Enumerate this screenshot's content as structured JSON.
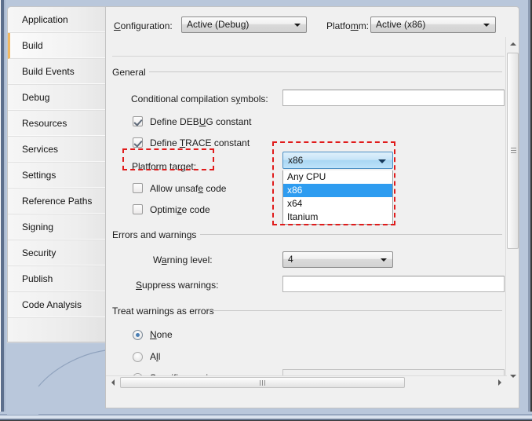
{
  "sidebar": {
    "items": [
      {
        "label": "Application",
        "selected": false
      },
      {
        "label": "Build",
        "selected": true
      },
      {
        "label": "Build Events",
        "selected": false
      },
      {
        "label": "Debug",
        "selected": false
      },
      {
        "label": "Resources",
        "selected": false
      },
      {
        "label": "Services",
        "selected": false
      },
      {
        "label": "Settings",
        "selected": false
      },
      {
        "label": "Reference Paths",
        "selected": false
      },
      {
        "label": "Signing",
        "selected": false
      },
      {
        "label": "Security",
        "selected": false
      },
      {
        "label": "Publish",
        "selected": false
      },
      {
        "label": "Code Analysis",
        "selected": false
      }
    ]
  },
  "config_row": {
    "configuration_label": "Configuration:",
    "configuration_value": "Active (Debug)",
    "platform_label": "Platform:",
    "platform_value": "Active (x86)"
  },
  "general": {
    "heading": "General",
    "conditional_symbols_label": "Conditional compilation symbols:",
    "conditional_symbols_value": "",
    "define_debug_label": "Define DEBUG constant",
    "define_debug_checked": true,
    "define_trace_label": "Define TRACE constant",
    "define_trace_checked": true,
    "platform_target_label": "Platform target:",
    "platform_target_value": "x86",
    "platform_target_options": [
      "Any CPU",
      "x86",
      "x64",
      "Itanium"
    ],
    "platform_target_selected_index": 1,
    "allow_unsafe_label": "Allow unsafe code",
    "allow_unsafe_checked": false,
    "optimize_label": "Optimize code",
    "optimize_checked": false
  },
  "errors_warnings": {
    "heading": "Errors and warnings",
    "warning_level_label": "Warning level:",
    "warning_level_value": "4",
    "suppress_warnings_label": "Suppress warnings:",
    "suppress_warnings_value": ""
  },
  "treat_warnings": {
    "heading": "Treat warnings as errors",
    "options": [
      {
        "label": "None",
        "selected": true
      },
      {
        "label": "All",
        "selected": false
      },
      {
        "label": "Specific warnings:",
        "selected": false
      }
    ],
    "specific_warnings_value": ""
  },
  "annotations": {
    "highlight_color": "#e01b1b",
    "boxes": [
      "platform-target-label",
      "platform-target-dropdown"
    ]
  },
  "icons": {
    "chevron_down": "dropdown-arrow",
    "scroll_up": "scroll-up-arrow",
    "scroll_down": "scroll-down-arrow",
    "scroll_left": "scroll-left-arrow",
    "scroll_right": "scroll-right-arrow"
  }
}
